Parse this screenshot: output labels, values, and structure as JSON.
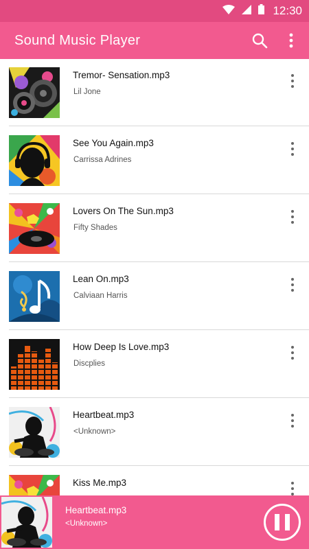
{
  "status_bar": {
    "time": "12:30"
  },
  "app_bar": {
    "title": "Sound Music Player"
  },
  "songs": [
    {
      "title": "Tremor- Sensation.mp3",
      "artist": "Lil Jone"
    },
    {
      "title": "See You Again.mp3",
      "artist": "Carrissa Adrines"
    },
    {
      "title": "Lovers On The Sun.mp3",
      "artist": "Fifty Shades"
    },
    {
      "title": "Lean On.mp3",
      "artist": "Calviaan Harris"
    },
    {
      "title": "How Deep Is Love.mp3",
      "artist": "Discplies"
    },
    {
      "title": "Heartbeat.mp3",
      "artist": "<Unknown>"
    },
    {
      "title": "Kiss Me.mp3",
      "artist": ""
    }
  ],
  "now_playing": {
    "title": "Heartbeat.mp3",
    "artist": "<Unknown>"
  },
  "colors": {
    "accent": "#f25a8f",
    "status_bar": "#e24a80"
  }
}
